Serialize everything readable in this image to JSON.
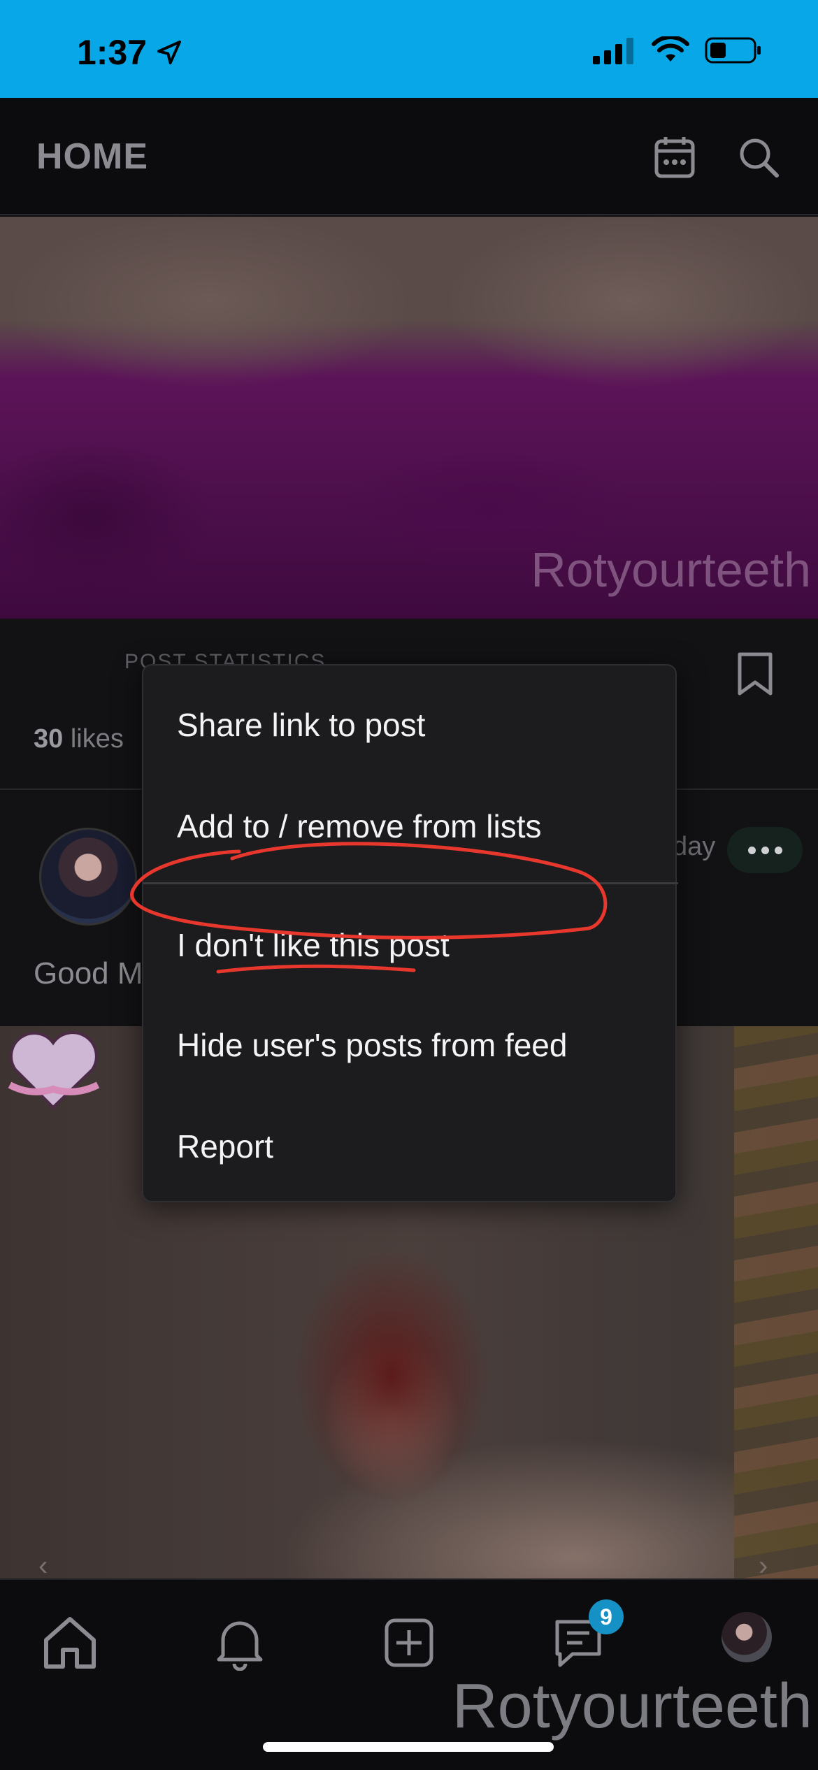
{
  "status": {
    "time": "1:37",
    "icons": [
      "location-arrow-icon",
      "signal-icon",
      "wifi-icon",
      "battery-icon"
    ]
  },
  "header": {
    "title": "HOME",
    "icons": [
      "calendar-icon",
      "search-icon"
    ]
  },
  "feed": {
    "post1": {
      "watermark": "Rotyourteeth",
      "likes_count": "30",
      "likes_label": "likes",
      "obscured_tool_text": "POST STATISTICS"
    },
    "post2": {
      "caption_fragment": "Good M",
      "date_fragment": "day"
    }
  },
  "context_menu": {
    "items": [
      "Share link to post",
      "Add to / remove from lists",
      "I don't like this post",
      "Hide user's posts from feed",
      "Report"
    ],
    "annotation_color": "#e8372c"
  },
  "bottom_nav": {
    "items": [
      "home-icon",
      "bell-icon",
      "add-post-icon",
      "messages-icon",
      "profile-avatar"
    ],
    "messages_badge": "9"
  },
  "overlay_watermark": "Rotyourteeth",
  "colors": {
    "status_bar": "#08a8e8",
    "background": "#101012",
    "menu_bg": "#1c1c1f",
    "badge": "#1591c6"
  }
}
